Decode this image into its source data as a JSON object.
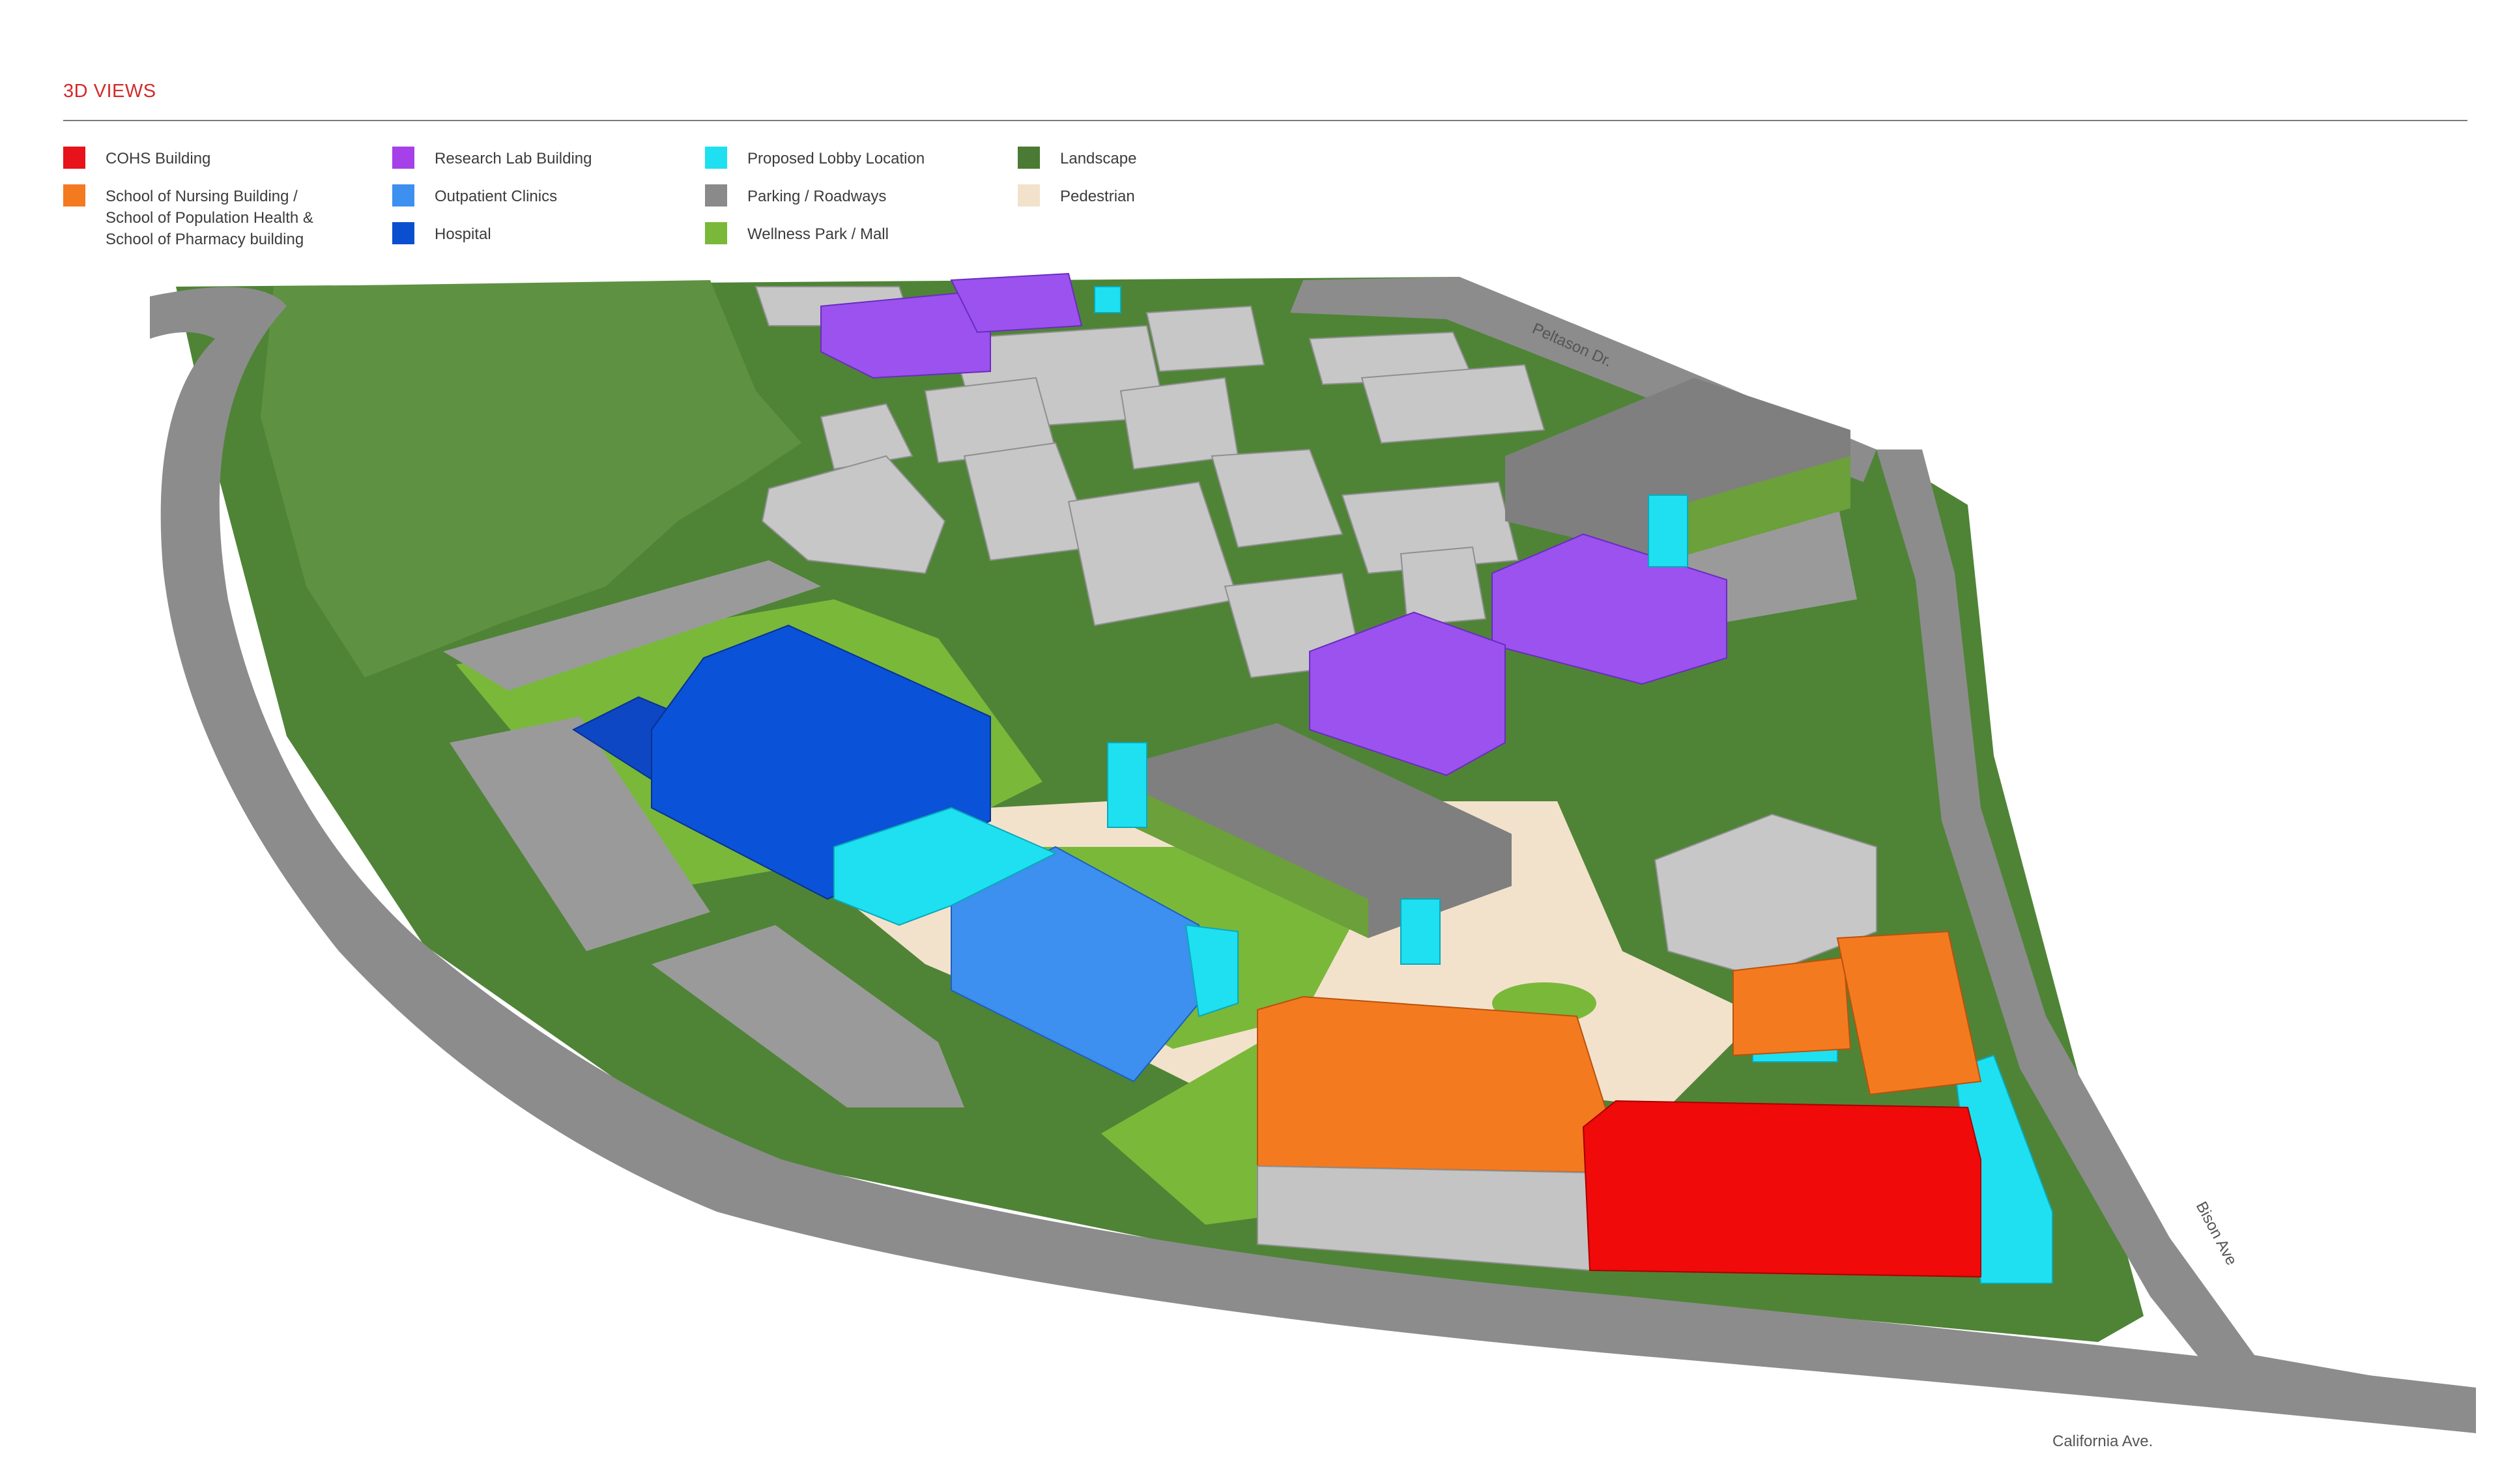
{
  "header": {
    "title": "3D VIEWS"
  },
  "legend": [
    {
      "label": "COHS Building",
      "color": "#e8121a"
    },
    {
      "label": "School of Nursing Building /\nSchool of Population Health &\nSchool of Pharmacy building",
      "color": "#f47a20"
    },
    {
      "label": "Research Lab Building",
      "color": "#a640e8"
    },
    {
      "label": "Outpatient Clinics",
      "color": "#3d8ff0"
    },
    {
      "label": "Hospital",
      "color": "#0a4fd0"
    },
    {
      "label": "Proposed Lobby Location",
      "color": "#1ee0f0"
    },
    {
      "label": "Parking / Roadways",
      "color": "#8a8a8a"
    },
    {
      "label": "Wellness Park / Mall",
      "color": "#7ab83a"
    },
    {
      "label": "Landscape",
      "color": "#4a7a34"
    },
    {
      "label": "Pedestrian",
      "color": "#f2e2cc"
    }
  ],
  "roads": {
    "peltason": "Peltason Dr.",
    "bison": "Bison Ave",
    "california": "California Ave."
  }
}
